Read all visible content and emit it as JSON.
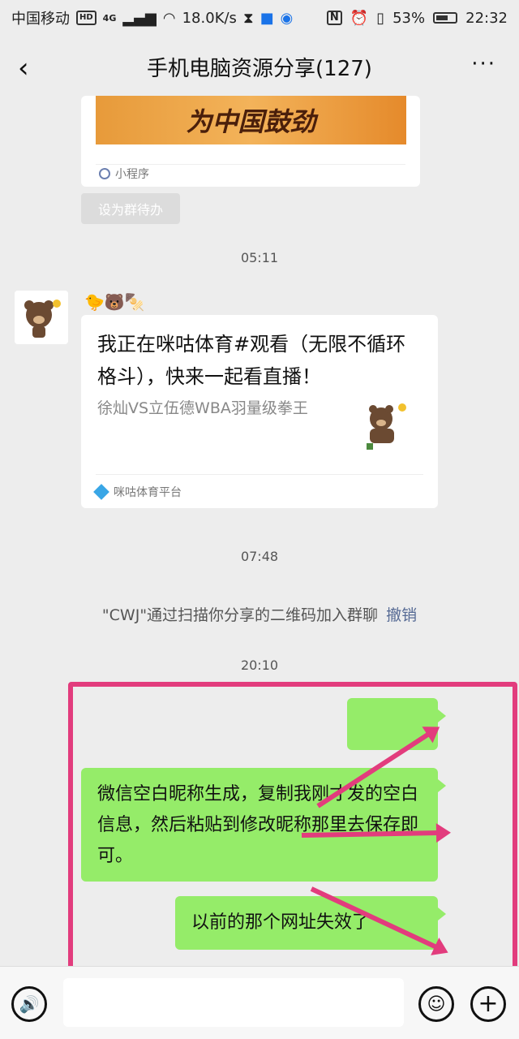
{
  "status_bar": {
    "carrier": "中国移动",
    "hd": "HD",
    "network": "4G",
    "speed": "18.0K/s",
    "nfc": "N",
    "battery": "53%",
    "time": "22:32"
  },
  "nav": {
    "title": "手机电脑资源分享(127)",
    "back_icon": "‹",
    "more_icon": "···"
  },
  "mini_program_card": {
    "banner_text": "为中国鼓劲",
    "label": "小程序"
  },
  "set_todo_label": "设为群待办",
  "times": [
    "05:11",
    "07:48",
    "20:10"
  ],
  "share_card": {
    "sender_emoji": "🐤🐻🍢",
    "title": "我正在咪咕体育#观看（无限不循环格斗），快来一起看直播！",
    "desc": "徐灿VS立伍德WBA羽量级拳王",
    "source": "咪咕体育平台"
  },
  "system_message": {
    "text": "\"CWJ\"通过扫描你分享的二维码加入群聊",
    "undo": "撤销"
  },
  "messages": [
    {
      "text": ""
    },
    {
      "text": "微信空白昵称生成，复制我刚才发的空白信息，然后粘贴到修改昵称那里去保存即可。"
    },
    {
      "text": "以前的那个网址失效了"
    }
  ],
  "input": {
    "voice_icon": "🔊",
    "emoji_icon": "☺",
    "plus_icon": "+"
  },
  "colors": {
    "bubble": "#95ec69",
    "highlight": "#e23c7d",
    "link": "#576b95"
  }
}
